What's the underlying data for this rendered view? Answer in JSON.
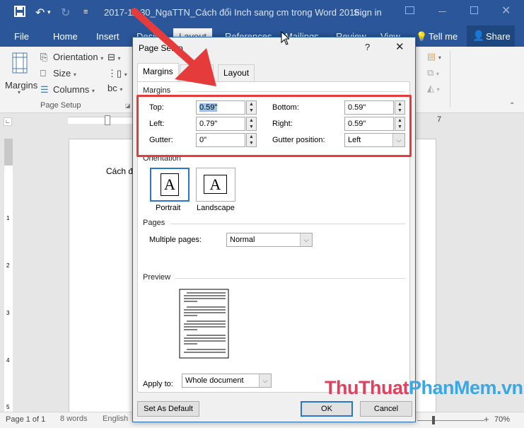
{
  "titlebar": {
    "doc_title": "2017-11-30_NgaTTN_Cách đổi Inch sang cm trong Word 2016...",
    "sign_in": "Sign in",
    "icons": [
      "save-icon",
      "undo-icon",
      "redo-icon",
      "customize-qat-icon",
      "ribbon-display-icon",
      "minimize-icon",
      "maximize-icon",
      "close-icon"
    ]
  },
  "tabs": [
    {
      "label": "File"
    },
    {
      "label": "Home"
    },
    {
      "label": "Insert"
    },
    {
      "label": "Design"
    },
    {
      "label": "Layout",
      "active": true
    },
    {
      "label": "References"
    },
    {
      "label": "Mailings"
    },
    {
      "label": "Review"
    },
    {
      "label": "View"
    }
  ],
  "tell_me": "Tell me",
  "share": "Share",
  "ribbon": {
    "margins": "Margins",
    "orientation": "Orientation",
    "size": "Size",
    "columns": "Columns",
    "group_label": "Page Setup"
  },
  "document": {
    "text": "Cách đ"
  },
  "ruler": {
    "h_mark": "7",
    "v_marks": [
      "1",
      "2",
      "3",
      "4",
      "5"
    ]
  },
  "status": {
    "page": "Page 1 of 1",
    "words": "8 words",
    "language": "English",
    "zoom": "70%"
  },
  "dialog": {
    "title": "Page Setup",
    "help": "?",
    "close": "✕",
    "tabs": [
      {
        "label": "Margins",
        "active": true
      },
      {
        "label": "Paper"
      },
      {
        "label": "Layout"
      }
    ],
    "margins_section": "Margins",
    "fields": {
      "top": {
        "label": "Top:",
        "value": "0.59\""
      },
      "bottom": {
        "label": "Bottom:",
        "value": "0.59\""
      },
      "left": {
        "label": "Left:",
        "value": "0.79\""
      },
      "right": {
        "label": "Right:",
        "value": "0.59\""
      },
      "gutter": {
        "label": "Gutter:",
        "value": "0\""
      },
      "gutter_position": {
        "label": "Gutter position:",
        "value": "Left"
      }
    },
    "orientation_section": "Orientation",
    "portrait": "Portrait",
    "landscape": "Landscape",
    "pages_section": "Pages",
    "multiple_pages": {
      "label": "Multiple pages:",
      "value": "Normal"
    },
    "preview_section": "Preview",
    "apply_to": {
      "label": "Apply to:",
      "value": "Whole document"
    },
    "set_default": "Set As Default",
    "ok": "OK",
    "cancel": "Cancel"
  },
  "watermark": {
    "part1": "ThuThuat",
    "part2": "PhanMem.vn"
  },
  "annotation_color": "#e53b3b",
  "accent_color": "#2b579a"
}
